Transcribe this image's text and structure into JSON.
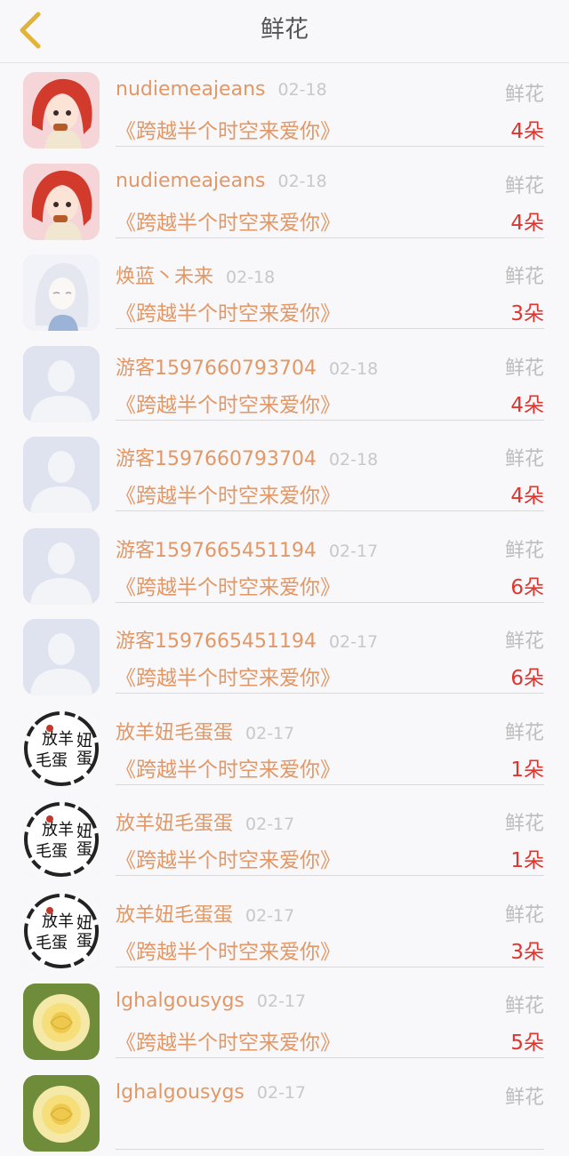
{
  "header": {
    "title": "鲜花"
  },
  "items": [
    {
      "name": "nudiemeajeans",
      "date": "02-18",
      "type": "鲜花",
      "book": "《跨越半个时空来爱你》",
      "count": "4朵",
      "avatar": "anime-red-hair"
    },
    {
      "name": "nudiemeajeans",
      "date": "02-18",
      "type": "鲜花",
      "book": "《跨越半个时空来爱你》",
      "count": "4朵",
      "avatar": "anime-red-hair"
    },
    {
      "name": "焕蓝丶未来",
      "date": "02-18",
      "type": "鲜花",
      "book": "《跨越半个时空来爱你》",
      "count": "3朵",
      "avatar": "anime-white-hair"
    },
    {
      "name": "游客1597660793704",
      "date": "02-18",
      "type": "鲜花",
      "book": "《跨越半个时空来爱你》",
      "count": "4朵",
      "avatar": "default-user"
    },
    {
      "name": "游客1597660793704",
      "date": "02-18",
      "type": "鲜花",
      "book": "《跨越半个时空来爱你》",
      "count": "4朵",
      "avatar": "default-user"
    },
    {
      "name": "游客1597665451194",
      "date": "02-17",
      "type": "鲜花",
      "book": "《跨越半个时空来爱你》",
      "count": "6朵",
      "avatar": "default-user"
    },
    {
      "name": "游客1597665451194",
      "date": "02-17",
      "type": "鲜花",
      "book": "《跨越半个时空来爱你》",
      "count": "6朵",
      "avatar": "default-user"
    },
    {
      "name": "放羊妞毛蛋蛋",
      "date": "02-17",
      "type": "鲜花",
      "book": "《跨越半个时空来爱你》",
      "count": "1朵",
      "avatar": "calligraphy-seal"
    },
    {
      "name": "放羊妞毛蛋蛋",
      "date": "02-17",
      "type": "鲜花",
      "book": "《跨越半个时空来爱你》",
      "count": "1朵",
      "avatar": "calligraphy-seal"
    },
    {
      "name": "放羊妞毛蛋蛋",
      "date": "02-17",
      "type": "鲜花",
      "book": "《跨越半个时空来爱你》",
      "count": "3朵",
      "avatar": "calligraphy-seal"
    },
    {
      "name": "lghalgousygs",
      "date": "02-17",
      "type": "鲜花",
      "book": "《跨越半个时空来爱你》",
      "count": "5朵",
      "avatar": "yellow-rose"
    },
    {
      "name": "lghalgousygs",
      "date": "02-17",
      "type": "鲜花",
      "book": "",
      "count": "",
      "avatar": "yellow-rose"
    }
  ],
  "seal_text": "放羊妞毛蛋蛋",
  "colors": {
    "accent": "#e29866",
    "count": "#e0342e",
    "back": "#e0b43a"
  }
}
